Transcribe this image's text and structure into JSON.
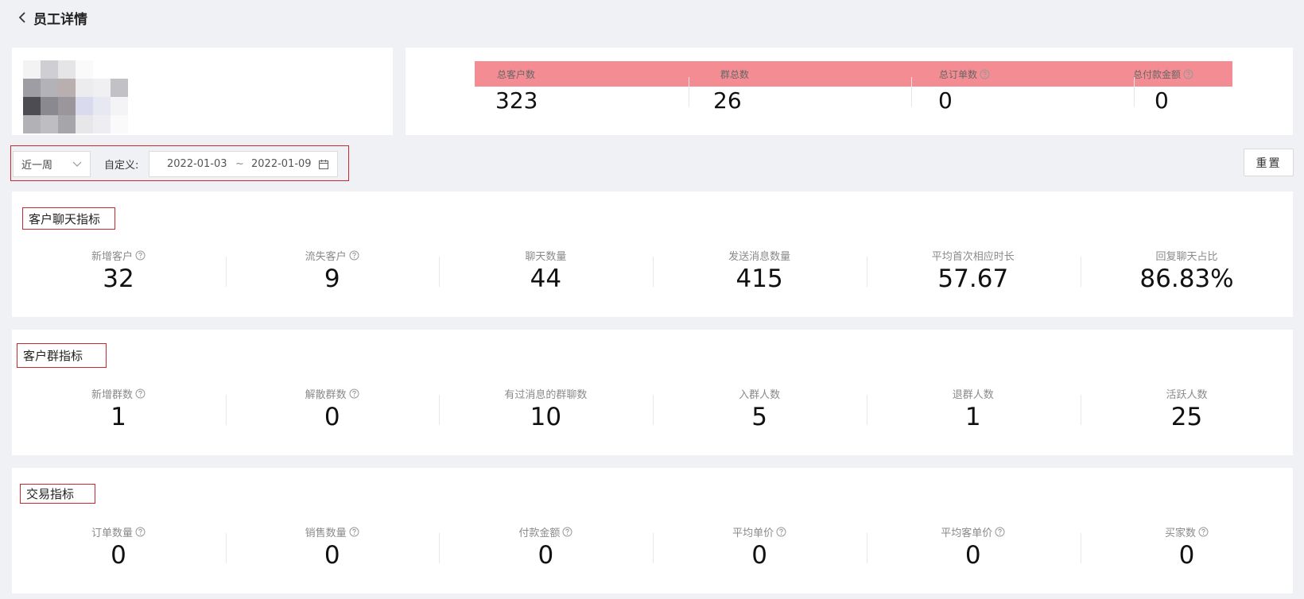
{
  "header": {
    "back_icon": "chevron-left-icon",
    "title": "员工详情"
  },
  "profile": {
    "avatar_colors": [
      [
        "#f3f3f4",
        "#cfcfd3",
        "#e5e5e8",
        "#fafafa",
        "#ffffff",
        "#ffffff"
      ],
      [
        "#9e9da3",
        "#b3b2b8",
        "#b9afb0",
        "#ececee",
        "#f0f0f2",
        "#c2c2c6"
      ],
      [
        "#4d4c52",
        "#8a898f",
        "#9a969b",
        "#d9daee",
        "#e8e8f2",
        "#f4f4f6"
      ],
      [
        "#b2b1b6",
        "#bebdc2",
        "#a6a5aa",
        "#e7e7ea",
        "#eeeef2",
        "#fafafa"
      ]
    ]
  },
  "summary": {
    "items": [
      {
        "label": "总客户数",
        "value": "323",
        "has_help": false
      },
      {
        "label": "群总数",
        "value": "26",
        "has_help": false
      },
      {
        "label": "总订单数",
        "value": "0",
        "has_help": true
      },
      {
        "label": "总付款金额",
        "value": "0",
        "has_help": true
      }
    ]
  },
  "filters": {
    "period_value": "近一周",
    "custom_label": "自定义:",
    "date_start": "2022-01-03",
    "date_separator": "~",
    "date_end": "2022-01-09",
    "reset_label": "重置"
  },
  "sections": [
    {
      "title": "客户聊天指标",
      "metrics": [
        {
          "label": "新增客户",
          "value": "32",
          "has_help": true
        },
        {
          "label": "流失客户",
          "value": "9",
          "has_help": true
        },
        {
          "label": "聊天数量",
          "value": "44",
          "has_help": false
        },
        {
          "label": "发送消息数量",
          "value": "415",
          "has_help": false
        },
        {
          "label": "平均首次相应时长",
          "value": "57.67",
          "has_help": false
        },
        {
          "label": "回复聊天占比",
          "value": "86.83%",
          "has_help": false
        }
      ]
    },
    {
      "title": "客户群指标",
      "metrics": [
        {
          "label": "新增群数",
          "value": "1",
          "has_help": true
        },
        {
          "label": "解散群数",
          "value": "0",
          "has_help": true
        },
        {
          "label": "有过消息的群聊数",
          "value": "10",
          "has_help": false
        },
        {
          "label": "入群人数",
          "value": "5",
          "has_help": false
        },
        {
          "label": "退群人数",
          "value": "1",
          "has_help": false
        },
        {
          "label": "活跃人数",
          "value": "25",
          "has_help": false
        }
      ]
    },
    {
      "title": "交易指标",
      "metrics": [
        {
          "label": "订单数量",
          "value": "0",
          "has_help": true
        },
        {
          "label": "销售数量",
          "value": "0",
          "has_help": true
        },
        {
          "label": "付款金额",
          "value": "0",
          "has_help": true
        },
        {
          "label": "平均单价",
          "value": "0",
          "has_help": true
        },
        {
          "label": "平均客单价",
          "value": "0",
          "has_help": true
        },
        {
          "label": "买家数",
          "value": "0",
          "has_help": true
        }
      ]
    }
  ],
  "colors": {
    "highlight_band": "#f38d93",
    "annotation_border": "#c8282f",
    "page_bg": "#f0f1f5"
  }
}
